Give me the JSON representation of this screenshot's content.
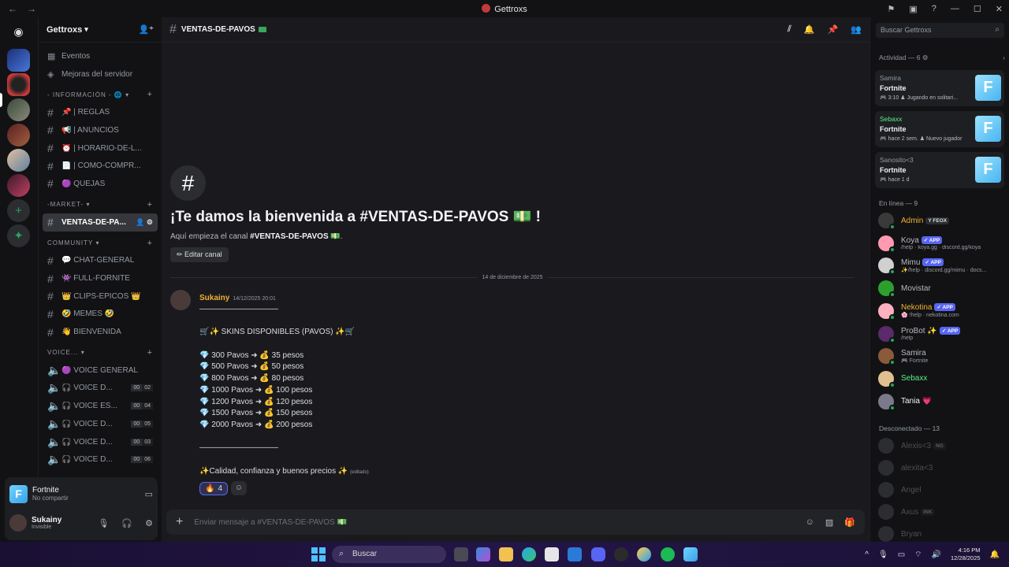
{
  "window": {
    "title": "Gettroxs",
    "nav_back": "←",
    "nav_fwd": "→"
  },
  "server": {
    "name": "Gettroxs"
  },
  "top_items": [
    {
      "label": "Eventos"
    },
    {
      "label": "Mejoras del servidor"
    }
  ],
  "categories": {
    "info": "- INFORMACIÓN -",
    "market": "-MARKET-",
    "community": "COMMUNITY",
    "voice": "VOICE..."
  },
  "info_channels": [
    {
      "label": "📌 | REGLAS"
    },
    {
      "label": "📢 | ANUNCIOS"
    },
    {
      "label": "⏰ | HORARIO-DE-L..."
    },
    {
      "label": "📄 | COMO-COMPR..."
    },
    {
      "label": "🟣 QUEJAS"
    }
  ],
  "market_channels": [
    {
      "label": "VENTAS-DE-PA..."
    }
  ],
  "community_channels": [
    {
      "label": "💬 CHAT-GENERAL"
    },
    {
      "label": "👾 FULL-FORNITE"
    },
    {
      "label": "👑 CLIPS-EPICOS 👑"
    },
    {
      "label": "🤣 MEMES 🤣"
    },
    {
      "label": "👋 BIENVENIDA"
    }
  ],
  "voice_channels": [
    {
      "label": "🟣 VOICE GENERAL",
      "a": "",
      "b": ""
    },
    {
      "label": "🎧 VOICE D...",
      "a": "00",
      "b": "02"
    },
    {
      "label": "🎧 VOICE ES...",
      "a": "00",
      "b": "04"
    },
    {
      "label": "🎧 VOICE D...",
      "a": "00",
      "b": "05"
    },
    {
      "label": "🎧 VOICE D...",
      "a": "00",
      "b": "03"
    },
    {
      "label": "🎧 VOICE D...",
      "a": "00",
      "b": "06"
    }
  ],
  "user_panel": {
    "game": "Fortnite",
    "game_sub": "No compartir",
    "username": "Sukainy",
    "status": "Invisible"
  },
  "channel": {
    "name": "VENTAS-DE-PAVOS",
    "welcome_title": "¡Te damos la bienvenida a #VENTAS-DE-PAVOS 💵 !",
    "welcome_sub_prefix": "Aquí empieza el canal ",
    "welcome_sub_channel": "#VENTAS-DE-PAVOS 💵",
    "welcome_sub_suffix": ".",
    "edit_button": "✏ Editar canal",
    "date_divider": "14 de diciembre de 2025",
    "composer_placeholder": "Enviar mensaje a #VENTAS-DE-PAVOS 💵"
  },
  "message": {
    "author": "Sukainy",
    "time": "14/12/2025 20:01",
    "lines": [
      "——————————",
      "",
      "🛒✨ SKINS DISPONIBLES (PAVOS) ✨🛒",
      "",
      "💎 300 Pavos ➜ 💰 35 pesos",
      "💎 500 Pavos ➜ 💰 50 pesos",
      "💎 800 Pavos ➜ 💰 80 pesos",
      "💎 1000 Pavos ➜ 💰 100 pesos",
      "💎 1200 Pavos ➜ 💰 120 pesos",
      "💎 1500 Pavos ➜ 💰 150 pesos",
      "💎 2000 Pavos ➜ 💰 200 pesos",
      "",
      "——————————",
      "",
      "✨Calidad, confianza y buenos precios ✨"
    ],
    "edited": "(editado)",
    "reaction_emoji": "🔥",
    "reaction_count": "4"
  },
  "members": {
    "search_placeholder": "Buscar Gettroxs",
    "activity_header": "Actividad — 6",
    "activity": [
      {
        "name": "Samira",
        "game": "Fortnite",
        "sub": "🎮 3:10  ♟ Jugando en solitari..."
      },
      {
        "name": "Sebaxx",
        "game": "Fortnite",
        "sub": "🎮 hace 2 sem.  ♟ Nuevo jugador"
      },
      {
        "name": "Sanosito<3",
        "game": "Fortnite",
        "sub": "🎮 hace 1 d"
      }
    ],
    "online_header": "En línea — 9",
    "online": [
      {
        "name": "Admin",
        "color": "#f0b232",
        "tag": "Y FEOX",
        "tag_style": "dark",
        "sub": ""
      },
      {
        "name": "Koya",
        "color": "#b5bac1",
        "tag": "✓ APP",
        "tag_style": "app",
        "sub": "/help · koya.gg · discord.gg/koya"
      },
      {
        "name": "Mimu",
        "color": "#b5bac1",
        "tag": "✓ APP",
        "tag_style": "app",
        "sub": "✨/help · discord.gg/mimu · docs..."
      },
      {
        "name": "Movistar",
        "color": "#b5bac1",
        "tag": "",
        "tag_style": "",
        "sub": ""
      },
      {
        "name": "Nekotina",
        "color": "#f0b232",
        "tag": "✓ APP",
        "tag_style": "app",
        "sub": "🌸 !help · nekotina.com"
      },
      {
        "name": "ProBot ✨",
        "color": "#b5bac1",
        "tag": "✓ APP",
        "tag_style": "app",
        "sub": "/help"
      },
      {
        "name": "Samira",
        "color": "#b5bac1",
        "tag": "",
        "tag_style": "",
        "sub": "🎮 Fortnite"
      },
      {
        "name": "Sebaxx",
        "color": "#57f287",
        "tag": "",
        "tag_style": "",
        "sub": ""
      },
      {
        "name": "Tania 💗",
        "color": "#f2f3f5",
        "tag": "",
        "tag_style": "",
        "sub": ""
      }
    ],
    "offline_header": "Desconectado — 13",
    "offline": [
      {
        "name": "Alexis<3",
        "tag": "NG"
      },
      {
        "name": "alexita<3",
        "tag": ""
      },
      {
        "name": "Angel",
        "tag": ""
      },
      {
        "name": "Axus",
        "tag": "INK"
      },
      {
        "name": "Bryan",
        "tag": ""
      }
    ]
  },
  "taskbar": {
    "search": "Buscar",
    "time": "4:16 PM",
    "date": "12/28/2025"
  }
}
